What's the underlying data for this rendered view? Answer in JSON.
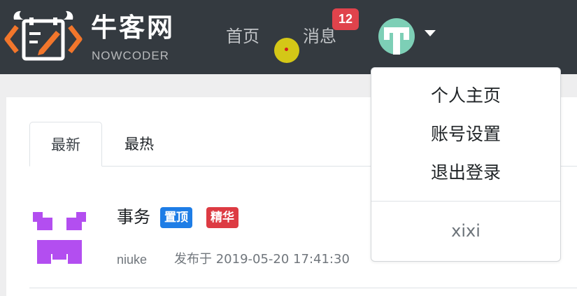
{
  "brand": {
    "name_cn": "牛客网",
    "name_en": "NOWCODER",
    "logo_icon": "nowcoder-bull-logo-icon",
    "colors": {
      "orange": "#f2762b",
      "header_bg": "#343a40"
    }
  },
  "nav": {
    "home_label": "首页",
    "messages_label": "消息",
    "messages_badge": "12",
    "user_avatar_icon": "user-avatar-icon",
    "dropdown_caret_icon": "caret-down-icon"
  },
  "tabs": [
    {
      "label": "最新",
      "active": true
    },
    {
      "label": "最热",
      "active": false
    }
  ],
  "posts": [
    {
      "title": "事务",
      "tags": [
        {
          "label": "置顶",
          "color": "#1e7de6"
        },
        {
          "label": "精华",
          "color": "#dd3b43"
        }
      ],
      "author": "niuke",
      "published": "发布于 2019-05-20 17:41:30",
      "avatar_icon": "purple-pixel-avatar-icon"
    }
  ],
  "user_menu": {
    "items": [
      "个人主页",
      "账号设置",
      "退出登录"
    ],
    "username": "xixi"
  }
}
